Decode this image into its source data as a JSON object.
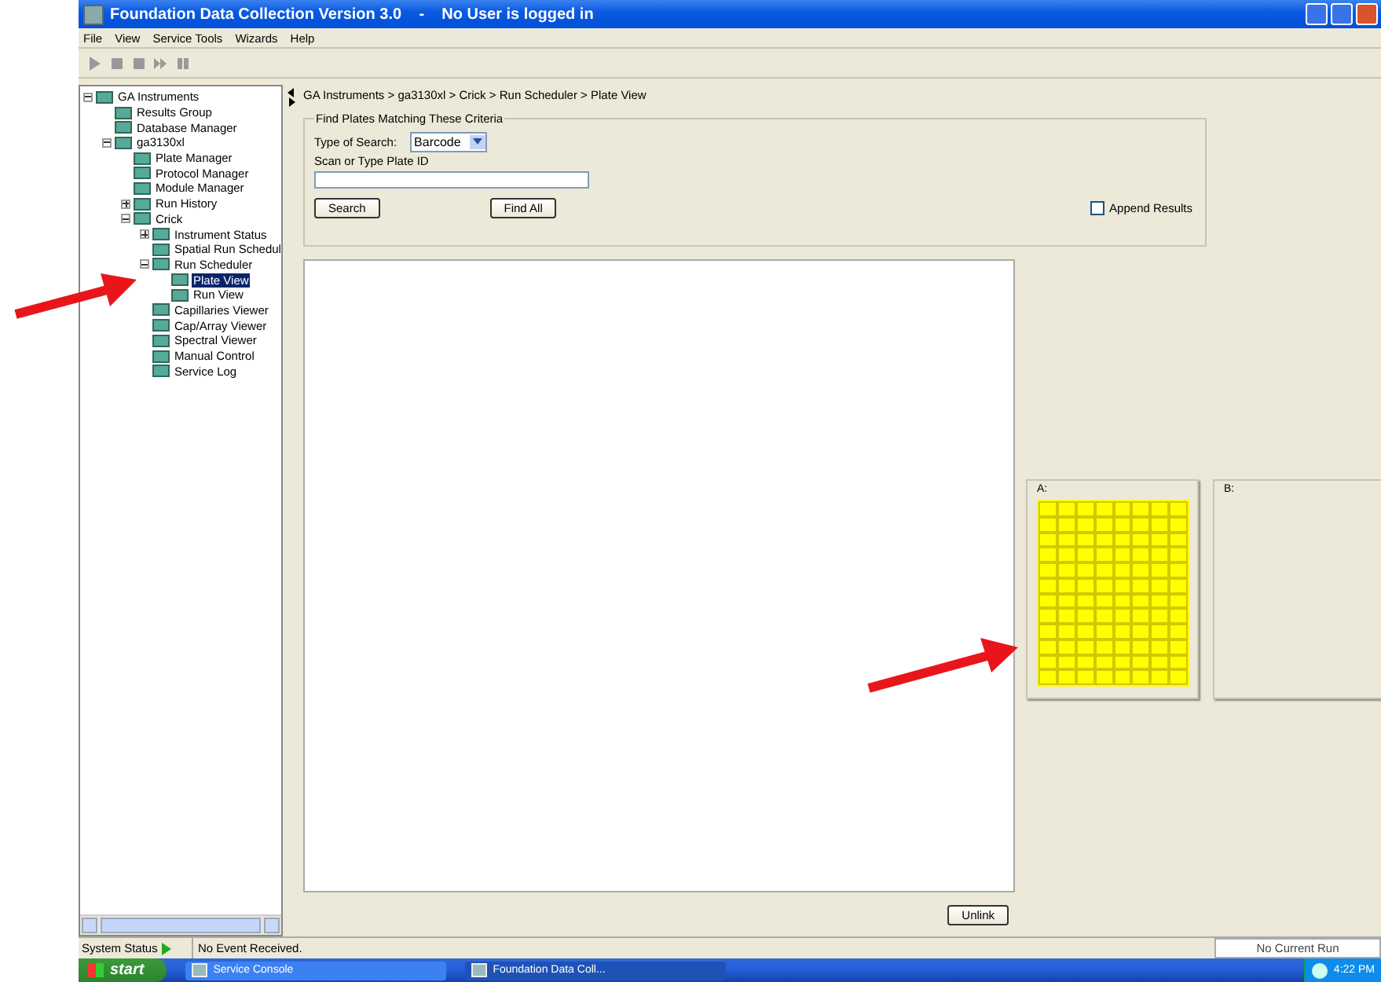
{
  "window": {
    "title": "Foundation Data Collection Version 3.0    -    No User is logged in"
  },
  "menu": [
    "File",
    "View",
    "Service Tools",
    "Wizards",
    "Help"
  ],
  "tree": [
    {
      "label": "GA Instruments",
      "expanded": true,
      "selected": false,
      "children": [
        {
          "label": "Results Group",
          "selected": false
        },
        {
          "label": "Database Manager",
          "selected": false
        },
        {
          "label": "ga3130xl",
          "expanded": true,
          "selected": false,
          "children": [
            {
              "label": "Plate Manager",
              "selected": false
            },
            {
              "label": "Protocol Manager",
              "selected": false
            },
            {
              "label": "Module Manager",
              "selected": false
            },
            {
              "label": "Run History",
              "expanded": false,
              "selected": false
            },
            {
              "label": "Crick",
              "expanded": true,
              "selected": false,
              "children": [
                {
                  "label": "Instrument Status",
                  "expanded": false,
                  "selected": false
                },
                {
                  "label": "Spatial Run Schedul",
                  "selected": false
                },
                {
                  "label": "Run Scheduler",
                  "expanded": true,
                  "selected": false,
                  "children": [
                    {
                      "label": "Plate View",
                      "selected": true
                    },
                    {
                      "label": "Run View",
                      "selected": false
                    }
                  ]
                },
                {
                  "label": "Capillaries Viewer",
                  "selected": false
                },
                {
                  "label": "Cap/Array Viewer",
                  "selected": false
                },
                {
                  "label": "Spectral Viewer",
                  "selected": false
                },
                {
                  "label": "Manual Control",
                  "selected": false
                },
                {
                  "label": "Service Log",
                  "selected": false
                }
              ]
            }
          ]
        }
      ]
    }
  ],
  "breadcrumb": "GA Instruments > ga3130xl > Crick > Run Scheduler > Plate View",
  "criteria": {
    "legend": "Find Plates Matching These Criteria",
    "type_label": "Type of Search:",
    "type_value": "Barcode",
    "id_label": "Scan or Type Plate ID",
    "search_button": "Search",
    "find_all_button": "Find All",
    "append": {
      "label": "Append Results",
      "checked": false
    }
  },
  "plates": [
    {
      "label": "A:",
      "filled": true
    },
    {
      "label": "B:",
      "filled": false
    }
  ],
  "unlink_button": "Unlink",
  "status_bar": {
    "label": "System Status",
    "message": "No Event Received.",
    "run": "No Current Run"
  },
  "taskbar": {
    "start": "start",
    "tasks": [
      {
        "label": "Service Console",
        "selected": false
      },
      {
        "label": "Foundation Data Coll...",
        "selected": true
      }
    ],
    "clock": "4:22 PM"
  }
}
